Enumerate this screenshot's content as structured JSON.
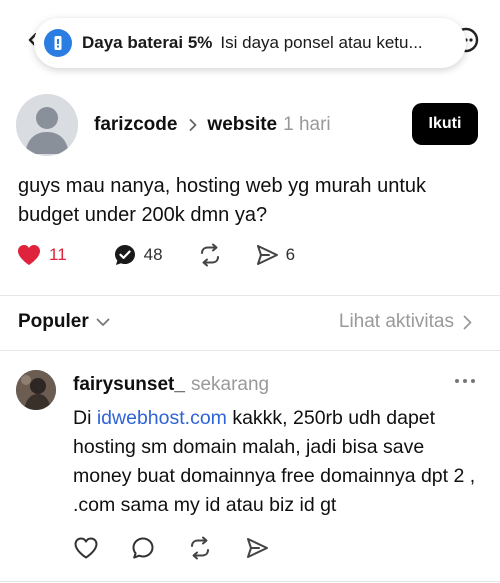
{
  "toast": {
    "title": "Daya baterai 5%",
    "message": "Isi daya ponsel atau ketu..."
  },
  "post": {
    "username": "farizcode",
    "topic": "website",
    "time": "1 hari",
    "follow_label": "Ikuti",
    "text": "guys mau nanya, hosting web yg murah untuk budget under 200k dmn ya?",
    "likes": "11",
    "replies": "48",
    "shares": "6",
    "liked": true
  },
  "sort": {
    "label": "Populer",
    "activity_label": "Lihat aktivitas"
  },
  "reply": {
    "username": "fairysunset_",
    "time": "sekarang",
    "text_prefix": "Di ",
    "link": "idwebhost.com",
    "text_suffix": " kakkk, 250rb udh dapet hosting sm domain malah, jadi bisa save money buat domainnya free domainnya dpt 2 , .com sama my id atau biz id gt"
  },
  "colors": {
    "like_active": "#e0233c",
    "link": "#2f64d6",
    "toast_icon": "#2a7de1"
  }
}
